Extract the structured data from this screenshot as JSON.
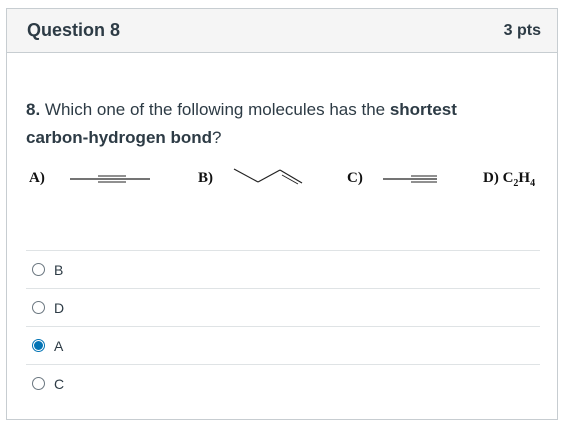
{
  "header": {
    "title": "Question 8",
    "points": "3 pts"
  },
  "question": {
    "number": "8.",
    "text_before": " Which one of the following molecules has the ",
    "bold": "shortest",
    "line2_bold": "carbon-hydrogen bond",
    "text_after": "?"
  },
  "options": {
    "a_label": "A)",
    "b_label": "B)",
    "c_label": "C)",
    "d_label": "D) C",
    "d_sub1": "2",
    "d_mid": "H",
    "d_sub2": "4"
  },
  "answers": [
    {
      "label": "B",
      "selected": false
    },
    {
      "label": "D",
      "selected": false
    },
    {
      "label": "A",
      "selected": true
    },
    {
      "label": "C",
      "selected": false
    }
  ],
  "colors": {
    "accent": "#0374b5",
    "border": "#c7cdd1",
    "header_bg": "#f5f5f5"
  }
}
